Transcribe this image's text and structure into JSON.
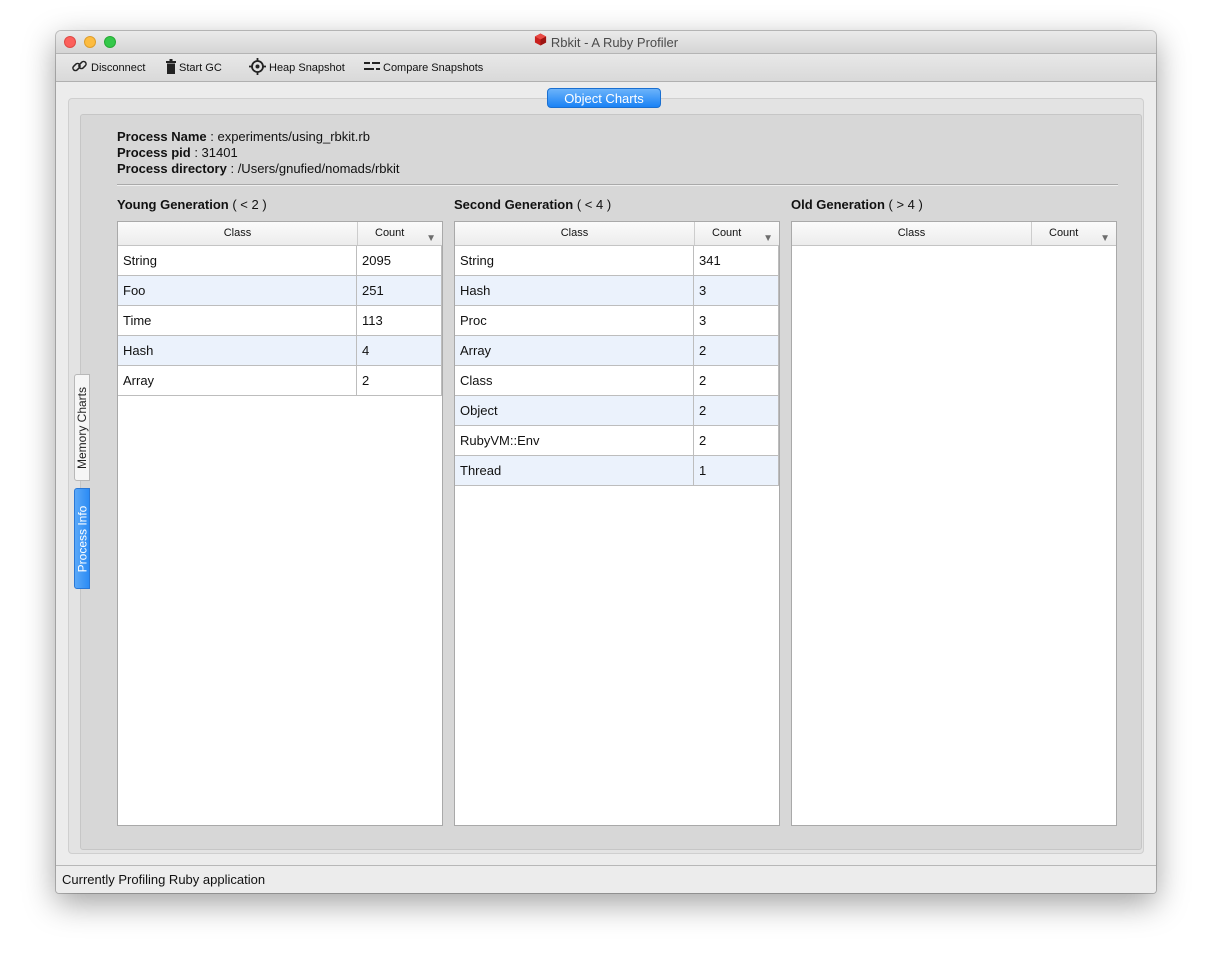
{
  "window": {
    "title": "Rbkit - A Ruby Profiler",
    "app_icon": "ruby-gem-icon"
  },
  "toolbar": {
    "disconnect_label": "Disconnect",
    "start_gc_label": "Start GC",
    "heap_snapshot_label": "Heap Snapshot",
    "compare_snapshots_label": "Compare  Snapshots"
  },
  "tabs": {
    "active": "Object Charts",
    "side_memory": "Memory Charts",
    "side_process": "Process Info"
  },
  "process": {
    "name_label": "Process Name",
    "name": "experiments/using_rbkit.rb",
    "pid_label": "Process pid",
    "pid": "31401",
    "dir_label": "Process directory",
    "dir": "/Users/gnufied/nomads/rbkit"
  },
  "generations": {
    "young": {
      "title": "Young Generation",
      "range": "( < 2 )",
      "class_header": "Class",
      "count_header": "Count",
      "rows": [
        {
          "class": "String",
          "count": "2095"
        },
        {
          "class": "Foo",
          "count": "251"
        },
        {
          "class": "Time",
          "count": "113"
        },
        {
          "class": "Hash",
          "count": "4"
        },
        {
          "class": "Array",
          "count": "2"
        }
      ]
    },
    "second": {
      "title": "Second Generation",
      "range": "( < 4 )",
      "class_header": "Class",
      "count_header": "Count",
      "rows": [
        {
          "class": "String",
          "count": "341"
        },
        {
          "class": "Hash",
          "count": "3"
        },
        {
          "class": "Proc",
          "count": "3"
        },
        {
          "class": "Array",
          "count": "2"
        },
        {
          "class": "Class",
          "count": "2"
        },
        {
          "class": "Object",
          "count": "2"
        },
        {
          "class": "RubyVM::Env",
          "count": "2"
        },
        {
          "class": "Thread",
          "count": "1"
        }
      ]
    },
    "old": {
      "title": "Old Generation",
      "range": "( > 4 )",
      "class_header": "Class",
      "count_header": "Count",
      "rows": []
    }
  },
  "status": {
    "text": "Currently Profiling Ruby application"
  },
  "colors": {
    "accent": "#1a82f5",
    "alt_row": "#ebf2fc",
    "close": "#fc605c",
    "minimize": "#fdbc40",
    "maximize": "#34c84a"
  }
}
